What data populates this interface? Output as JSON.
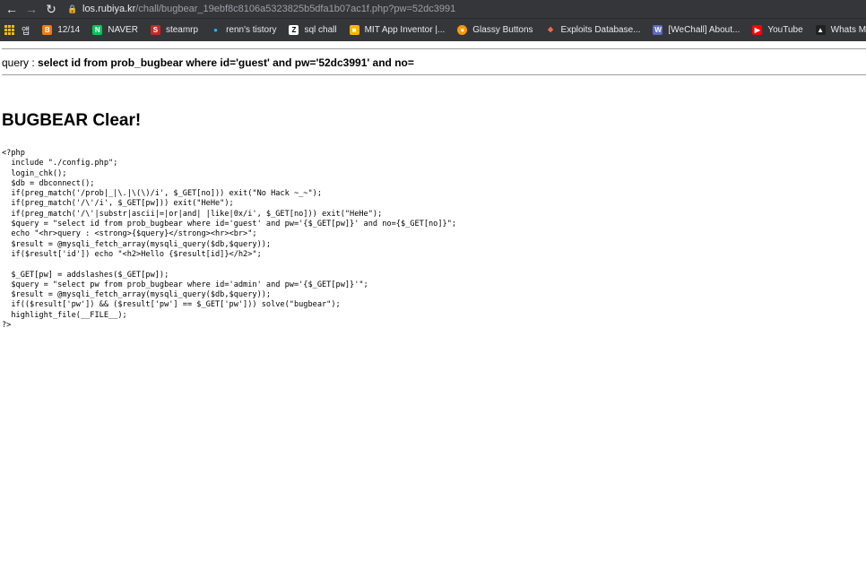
{
  "browser": {
    "url_host": "los.rubiya.kr",
    "url_path": "/chall/bugbear_19ebf8c8106a5323825b5dfa1b07ac1f.php?pw=52dc3991",
    "bookmarks": [
      {
        "label": "앱",
        "icon": "apps-icon",
        "color": "#fbbc04"
      },
      {
        "label": "12/14",
        "icon": "blogger-icon",
        "color": "#f57c00"
      },
      {
        "label": "NAVER",
        "icon": "naver-icon",
        "color": "#03c75a"
      },
      {
        "label": "steamrp",
        "icon": "steamrp-icon",
        "color": "#c62828"
      },
      {
        "label": "renn's tistory",
        "icon": "tistory-icon",
        "color": "#29b6f6"
      },
      {
        "label": "sql chall",
        "icon": "z-icon",
        "color": "#ffffff"
      },
      {
        "label": "MIT App Inventor |...",
        "icon": "app-inventor-icon",
        "color": "#ffb300"
      },
      {
        "label": "Glassy Buttons",
        "icon": "glassy-buttons-icon",
        "color": "#ff9800"
      },
      {
        "label": "Exploits Database...",
        "icon": "exploits-db-icon",
        "color": "#ff7043"
      },
      {
        "label": "[WeChall] About...",
        "icon": "wechall-icon",
        "color": "#5c6bc0"
      },
      {
        "label": "YouTube",
        "icon": "youtube-icon",
        "color": "#ff0000"
      },
      {
        "label": "Whats My IP Ad",
        "icon": "whatsmyip-icon",
        "color": "#212121"
      }
    ]
  },
  "query": {
    "label": "query : ",
    "text": "select id from prob_bugbear where id='guest' and pw='52dc3991' and no="
  },
  "heading": "BUGBEAR Clear!",
  "source_lines": [
    "<?php",
    "  include \"./config.php\";",
    "  login_chk();",
    "  $db = dbconnect();",
    "  if(preg_match('/prob|_|\\.|\\(\\)/i', $_GET[no])) exit(\"No Hack ~_~\");",
    "  if(preg_match('/\\'/i', $_GET[pw])) exit(\"HeHe\");",
    "  if(preg_match('/\\'|substr|ascii|=|or|and| |like|0x/i', $_GET[no])) exit(\"HeHe\");",
    "  $query = \"select id from prob_bugbear where id='guest' and pw='{$_GET[pw]}' and no={$_GET[no]}\";",
    "  echo \"<hr>query : <strong>{$query}</strong><hr><br>\";",
    "  $result = @mysqli_fetch_array(mysqli_query($db,$query));",
    "  if($result['id']) echo \"<h2>Hello {$result[id]}</h2>\";",
    "",
    "  $_GET[pw] = addslashes($_GET[pw]);",
    "  $query = \"select pw from prob_bugbear where id='admin' and pw='{$_GET[pw]}'\";",
    "  $result = @mysqli_fetch_array(mysqli_query($db,$query));",
    "  if(($result['pw']) && ($result['pw'] == $_GET['pw'])) solve(\"bugbear\");",
    "  highlight_file(__FILE__);",
    "?>"
  ]
}
